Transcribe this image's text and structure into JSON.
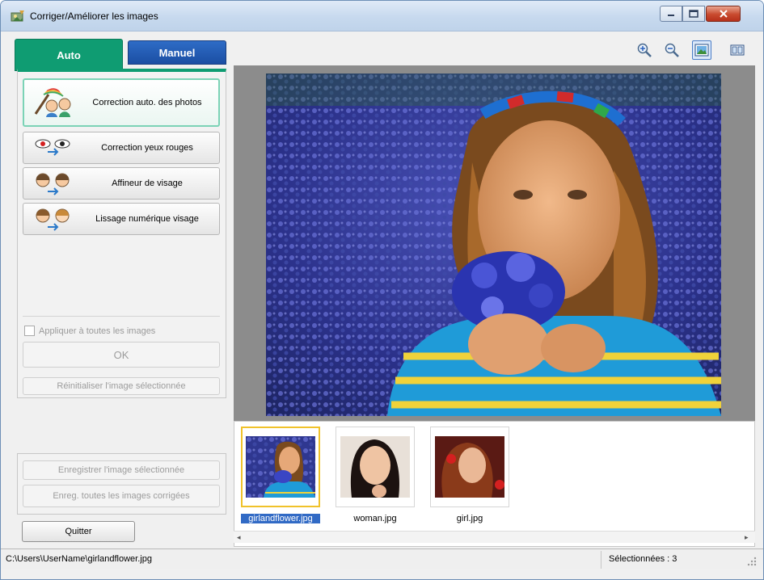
{
  "window": {
    "title": "Corriger/Améliorer les images",
    "controls": {
      "minimize": "minimize-icon",
      "maximize": "maximize-icon",
      "close": "close-icon"
    }
  },
  "left": {
    "tabs": [
      {
        "label": "Auto",
        "active": true
      },
      {
        "label": "Manuel",
        "active": false
      }
    ],
    "functions": [
      {
        "label": "Correction auto. des photos",
        "icon": "auto-photo-fix-icon",
        "active": true
      },
      {
        "label": "Correction yeux rouges",
        "icon": "red-eye-icon",
        "active": false
      },
      {
        "label": "Affineur de visage",
        "icon": "face-sharpener-icon",
        "active": false
      },
      {
        "label": "Lissage numérique visage",
        "icon": "digital-face-smoothing-icon",
        "active": false
      }
    ],
    "apply_all_label": "Appliquer à toutes les images",
    "ok_label": "OK",
    "reset_label": "Réinitialiser l'image sélectionnée",
    "save_selected_label": "Enregistrer l'image sélectionnée",
    "save_all_label": "Enreg. toutes les images corrigées",
    "quit_label": "Quitter"
  },
  "toolbar": {
    "icons": [
      "zoom-in-icon",
      "zoom-out-icon",
      "whole-image-view-icon",
      "compare-view-icon"
    ]
  },
  "thumbnails": [
    {
      "name": "girlandflower.jpg",
      "selected": true
    },
    {
      "name": "woman.jpg",
      "selected": false
    },
    {
      "name": "girl.jpg",
      "selected": false
    }
  ],
  "status": {
    "path": "C:\\Users\\UserName\\girlandflower.jpg",
    "selected": "Sélectionnées : 3"
  },
  "colors": {
    "auto_tab": "#0f9c72",
    "manuel_tab": "#2a62be",
    "selection_highlight": "#316ac5",
    "thumb_selected_border": "#f0c22b"
  }
}
